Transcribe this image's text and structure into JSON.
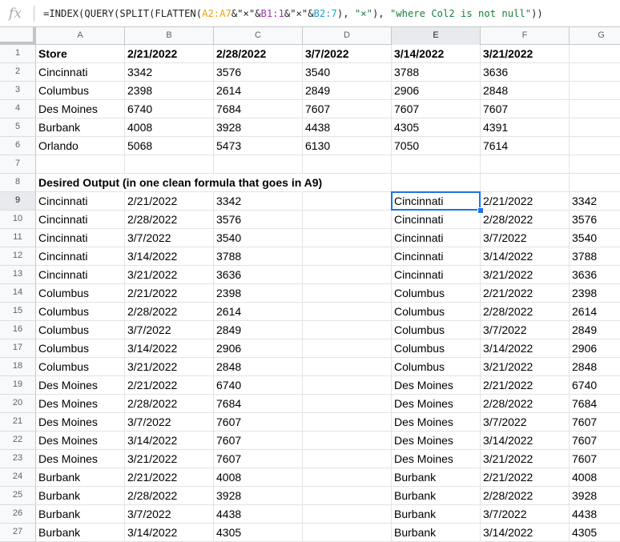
{
  "formula_bar": {
    "fx_label": "fx",
    "parts": [
      {
        "t": "=INDEX(QUERY(SPLIT(FLATTEN(",
        "c": ""
      },
      {
        "t": "A2:A7",
        "c": "rA"
      },
      {
        "t": "&\"×\"&",
        "c": ""
      },
      {
        "t": "B1:1",
        "c": "rB"
      },
      {
        "t": "&\"×\"&",
        "c": ""
      },
      {
        "t": "B2:7",
        "c": "rC"
      },
      {
        "t": "), ",
        "c": ""
      },
      {
        "t": "\"×\"",
        "c": "str"
      },
      {
        "t": "), ",
        "c": ""
      },
      {
        "t": "\"where Col2 is not null\"",
        "c": "str"
      },
      {
        "t": "))",
        "c": ""
      }
    ]
  },
  "columns": [
    "A",
    "B",
    "C",
    "D",
    "E",
    "F",
    "G"
  ],
  "selected_column": "E",
  "selected_row": 9,
  "rows": [
    {
      "n": 1,
      "cells": [
        "Store",
        "2/21/2022",
        "2/28/2022",
        "3/7/2022",
        "3/14/2022",
        "3/21/2022",
        ""
      ],
      "bold": true
    },
    {
      "n": 2,
      "cells": [
        "Cincinnati",
        "3342",
        "3576",
        "3540",
        "3788",
        "3636",
        ""
      ]
    },
    {
      "n": 3,
      "cells": [
        "Columbus",
        "2398",
        "2614",
        "2849",
        "2906",
        "2848",
        ""
      ]
    },
    {
      "n": 4,
      "cells": [
        "Des Moines",
        "6740",
        "7684",
        "7607",
        "7607",
        "7607",
        ""
      ]
    },
    {
      "n": 5,
      "cells": [
        "Burbank",
        "4008",
        "3928",
        "4438",
        "4305",
        "4391",
        ""
      ]
    },
    {
      "n": 6,
      "cells": [
        "Orlando",
        "5068",
        "5473",
        "6130",
        "7050",
        "7614",
        ""
      ]
    },
    {
      "n": 7,
      "cells": [
        "",
        "",
        "",
        "",
        "",
        "",
        ""
      ]
    },
    {
      "n": 8,
      "cells": [
        "Desired Output (in one clean formula that goes in A9)",
        "",
        "",
        "",
        "",
        "",
        ""
      ],
      "bold": true,
      "overflow": true
    },
    {
      "n": 9,
      "cells": [
        "Cincinnati",
        "2/21/2022",
        "3342",
        "",
        "Cincinnati",
        "2/21/2022",
        "3342"
      ]
    },
    {
      "n": 10,
      "cells": [
        "Cincinnati",
        "2/28/2022",
        "3576",
        "",
        "Cincinnati",
        "2/28/2022",
        "3576"
      ]
    },
    {
      "n": 11,
      "cells": [
        "Cincinnati",
        "3/7/2022",
        "3540",
        "",
        "Cincinnati",
        "3/7/2022",
        "3540"
      ]
    },
    {
      "n": 12,
      "cells": [
        "Cincinnati",
        "3/14/2022",
        "3788",
        "",
        "Cincinnati",
        "3/14/2022",
        "3788"
      ]
    },
    {
      "n": 13,
      "cells": [
        "Cincinnati",
        "3/21/2022",
        "3636",
        "",
        "Cincinnati",
        "3/21/2022",
        "3636"
      ]
    },
    {
      "n": 14,
      "cells": [
        "Columbus",
        "2/21/2022",
        "2398",
        "",
        "Columbus",
        "2/21/2022",
        "2398"
      ]
    },
    {
      "n": 15,
      "cells": [
        "Columbus",
        "2/28/2022",
        "2614",
        "",
        "Columbus",
        "2/28/2022",
        "2614"
      ]
    },
    {
      "n": 16,
      "cells": [
        "Columbus",
        "3/7/2022",
        "2849",
        "",
        "Columbus",
        "3/7/2022",
        "2849"
      ]
    },
    {
      "n": 17,
      "cells": [
        "Columbus",
        "3/14/2022",
        "2906",
        "",
        "Columbus",
        "3/14/2022",
        "2906"
      ]
    },
    {
      "n": 18,
      "cells": [
        "Columbus",
        "3/21/2022",
        "2848",
        "",
        "Columbus",
        "3/21/2022",
        "2848"
      ]
    },
    {
      "n": 19,
      "cells": [
        "Des Moines",
        "2/21/2022",
        "6740",
        "",
        "Des Moines",
        "2/21/2022",
        "6740"
      ]
    },
    {
      "n": 20,
      "cells": [
        "Des Moines",
        "2/28/2022",
        "7684",
        "",
        "Des Moines",
        "2/28/2022",
        "7684"
      ]
    },
    {
      "n": 21,
      "cells": [
        "Des Moines",
        "3/7/2022",
        "7607",
        "",
        "Des Moines",
        "3/7/2022",
        "7607"
      ]
    },
    {
      "n": 22,
      "cells": [
        "Des Moines",
        "3/14/2022",
        "7607",
        "",
        "Des Moines",
        "3/14/2022",
        "7607"
      ]
    },
    {
      "n": 23,
      "cells": [
        "Des Moines",
        "3/21/2022",
        "7607",
        "",
        "Des Moines",
        "3/21/2022",
        "7607"
      ]
    },
    {
      "n": 24,
      "cells": [
        "Burbank",
        "2/21/2022",
        "4008",
        "",
        "Burbank",
        "2/21/2022",
        "4008"
      ]
    },
    {
      "n": 25,
      "cells": [
        "Burbank",
        "2/28/2022",
        "3928",
        "",
        "Burbank",
        "2/28/2022",
        "3928"
      ]
    },
    {
      "n": 26,
      "cells": [
        "Burbank",
        "3/7/2022",
        "4438",
        "",
        "Burbank",
        "3/7/2022",
        "4438"
      ]
    },
    {
      "n": 27,
      "cells": [
        "Burbank",
        "3/14/2022",
        "4305",
        "",
        "Burbank",
        "3/14/2022",
        "4305"
      ]
    }
  ],
  "colors": {
    "selection": "#1a73e8",
    "header_bg": "#f8f9fa",
    "gridline": "#e2e3e3"
  }
}
